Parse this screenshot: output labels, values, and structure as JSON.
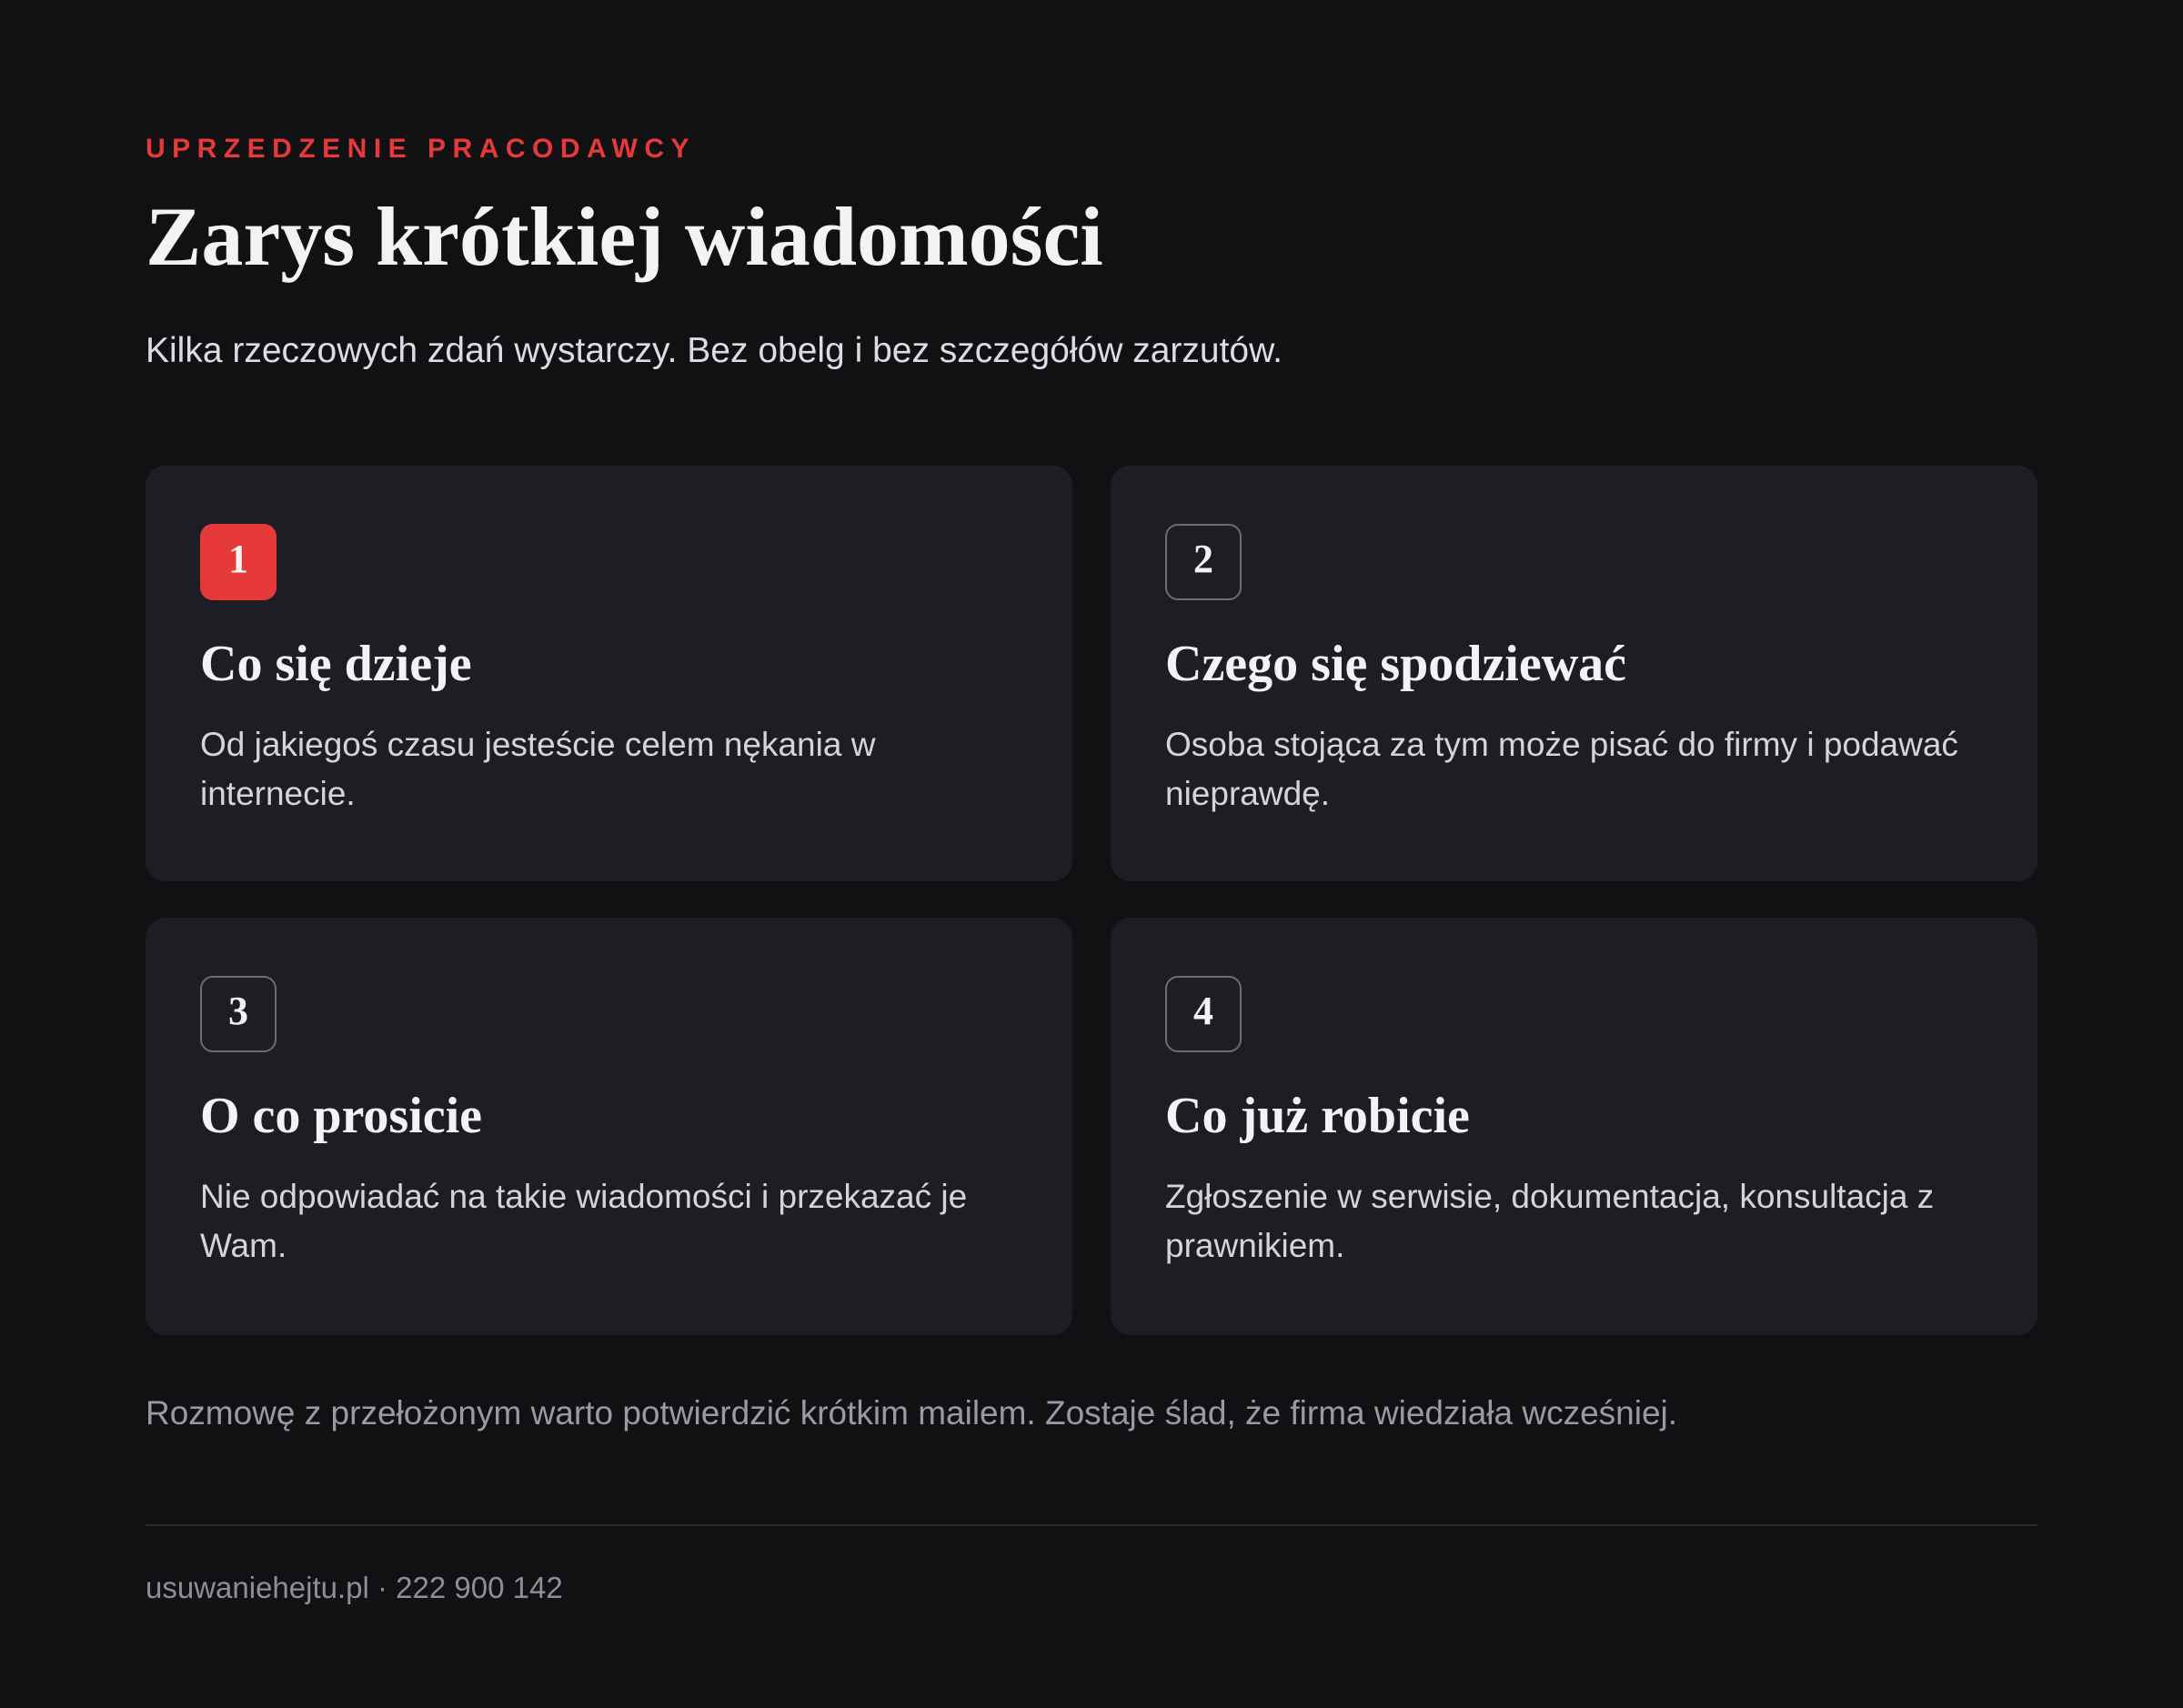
{
  "header": {
    "eyebrow": "UPRZEDZENIE PRACODAWCY",
    "title": "Zarys krótkiej wiadomości",
    "subtitle": "Kilka rzeczowych zdań wystarczy. Bez obelg i bez szczegółów zarzutów."
  },
  "cards": [
    {
      "number": "1",
      "title": "Co się dzieje",
      "text": "Od jakiegoś czasu jesteście celem nękania w internecie.",
      "active": true
    },
    {
      "number": "2",
      "title": "Czego się spodziewać",
      "text": "Osoba stojąca za tym może pisać do firmy i podawać nieprawdę.",
      "active": false
    },
    {
      "number": "3",
      "title": "O co prosicie",
      "text": "Nie odpowiadać na takie wiadomości i przekazać je Wam.",
      "active": false
    },
    {
      "number": "4",
      "title": "Co już robicie",
      "text": "Zgłoszenie w serwisie, dokumentacja, konsultacja z prawnikiem.",
      "active": false
    }
  ],
  "note": "Rozmowę z przełożonym warto potwierdzić krótkim mailem. Zostaje ślad, że firma wiedziała wcześniej.",
  "footer": {
    "text": "usuwaniehejtu.pl · 222 900 142"
  },
  "colors": {
    "background": "#111114",
    "card": "#1d1d23",
    "accent": "#e5393a"
  }
}
